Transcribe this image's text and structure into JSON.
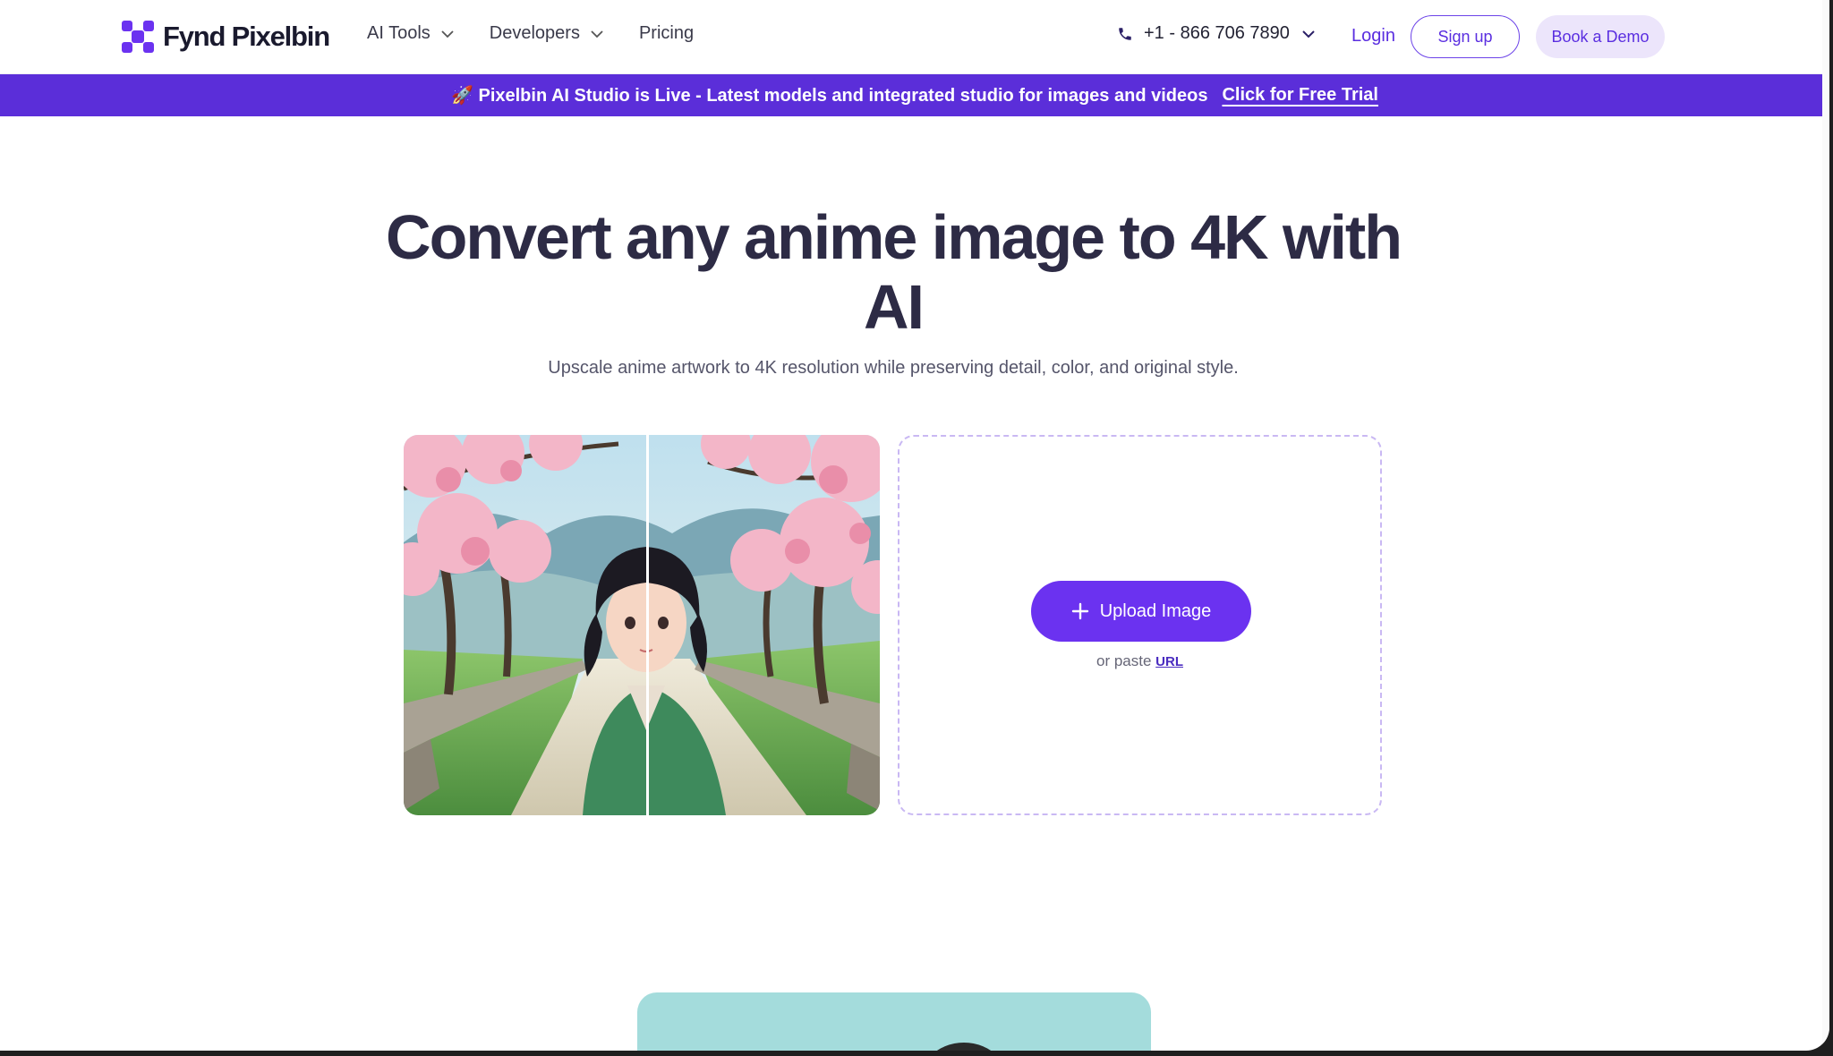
{
  "nav": {
    "logo_text": "Fynd Pixelbin",
    "items": [
      {
        "label": "AI Tools",
        "has_dropdown": true
      },
      {
        "label": "Developers",
        "has_dropdown": true
      },
      {
        "label": "Pricing",
        "has_dropdown": false
      }
    ],
    "phone": "+1 - 866 706 7890",
    "login": "Login",
    "signup": "Sign up",
    "demo": "Book a Demo"
  },
  "banner": {
    "emoji": "🚀",
    "text": "Pixelbin AI Studio is Live - Latest models and integrated studio for images and videos",
    "cta": "Click for Free Trial"
  },
  "hero": {
    "title": "Convert any anime image to 4K with AI",
    "subtitle": "Upscale anime artwork to 4K resolution while preserving detail, color, and original style."
  },
  "upload": {
    "button_label": "Upload Image",
    "paste_prefix": "or paste",
    "url_link": "URL"
  },
  "colors": {
    "brand_purple": "#5b2ed9",
    "button_purple": "#6b32f0",
    "title_color": "#2d2b45"
  }
}
